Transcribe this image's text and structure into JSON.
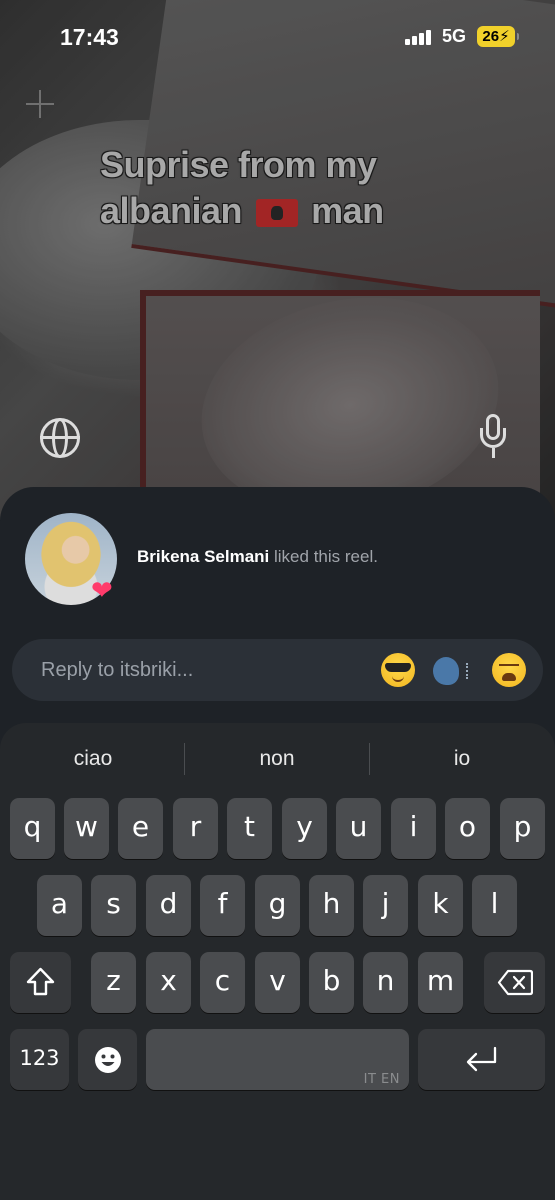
{
  "status_bar": {
    "time": "17:43",
    "network": "5G",
    "battery": "26"
  },
  "reel": {
    "caption_line1": "Suprise from my",
    "caption_line2_pre": "albanian",
    "caption_line2_post": "man",
    "flag_icon": "albania-flag-emoji"
  },
  "like_notice": {
    "user": "Brikena Selmani",
    "text": " liked this reel."
  },
  "reply": {
    "placeholder": "Reply to itsbriki...",
    "emojis": [
      "smiling-face-with-sunglasses",
      "speaking-head",
      "weary-face"
    ]
  },
  "keyboard": {
    "suggestions": [
      "ciao",
      "non",
      "io"
    ],
    "row1": [
      "q",
      "w",
      "e",
      "r",
      "t",
      "y",
      "u",
      "i",
      "o",
      "p"
    ],
    "row2": [
      "a",
      "s",
      "d",
      "f",
      "g",
      "h",
      "j",
      "k",
      "l"
    ],
    "row3": [
      "z",
      "x",
      "c",
      "v",
      "b",
      "n",
      "m"
    ],
    "numbers_label": "123",
    "space_tag": "IT EN",
    "colors": {
      "key": "#4a4c4f",
      "key_dark": "#36383b",
      "background": "#25282b"
    }
  },
  "colors": {
    "sheet": "#1e2227",
    "reply_box": "#2b3037",
    "battery": "#f1d12b"
  }
}
